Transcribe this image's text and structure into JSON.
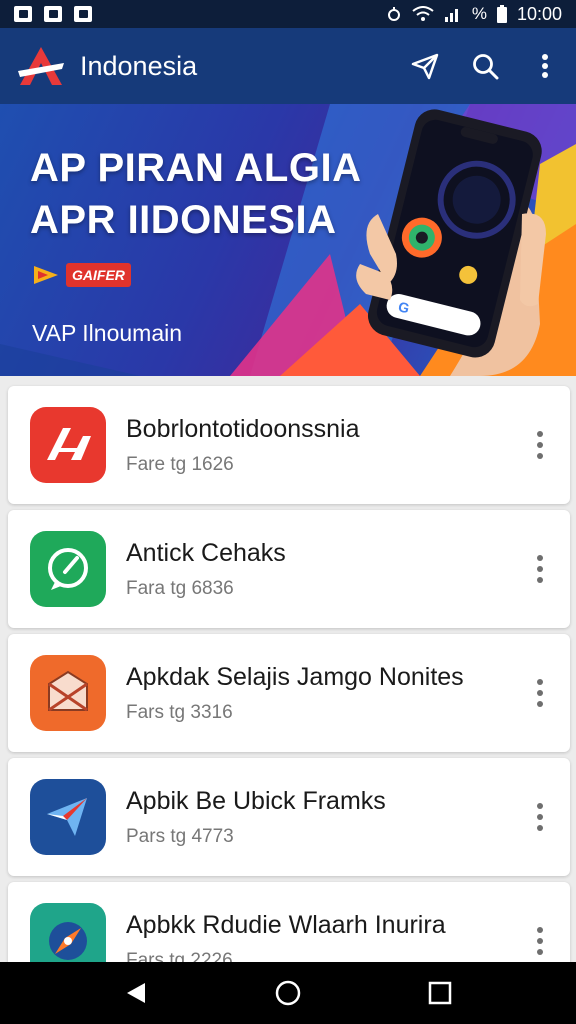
{
  "status_bar": {
    "time": "10:00",
    "battery_text": "%"
  },
  "app_bar": {
    "title": "Indonesia",
    "brand_color": "#163a7a",
    "logo_color": "#e8393a"
  },
  "banner": {
    "headline_line1": "AP PIRAN ALGIA",
    "headline_line2": "APR IIDONESIA",
    "badge": "GAIFER",
    "subtitle": "VAP Ilnoumain"
  },
  "apps": [
    {
      "title": "Bobrlontotidoonssnia",
      "subtitle": "Fare tg 1626",
      "icon": "arrow-logo-icon",
      "color": "#e8382e"
    },
    {
      "title": "Antick Cehaks",
      "subtitle": "Fara tg 6836",
      "icon": "chat-bubble-icon",
      "color": "#1fa95a"
    },
    {
      "title": "Apkdak Selajis Jamgo Nonites",
      "subtitle": "Fars tg 3316",
      "icon": "envelope-icon",
      "color": "#ef6a2b"
    },
    {
      "title": "Apbik Be Ubick Framks",
      "subtitle": "Pars tg 4773",
      "icon": "paper-plane-icon",
      "color": "#1e4f9a"
    },
    {
      "title": "Apbkk Rdudie Wlaarh Inurira",
      "subtitle": "Fars tg 2226",
      "icon": "compass-icon",
      "color": "#1fa58a"
    }
  ]
}
